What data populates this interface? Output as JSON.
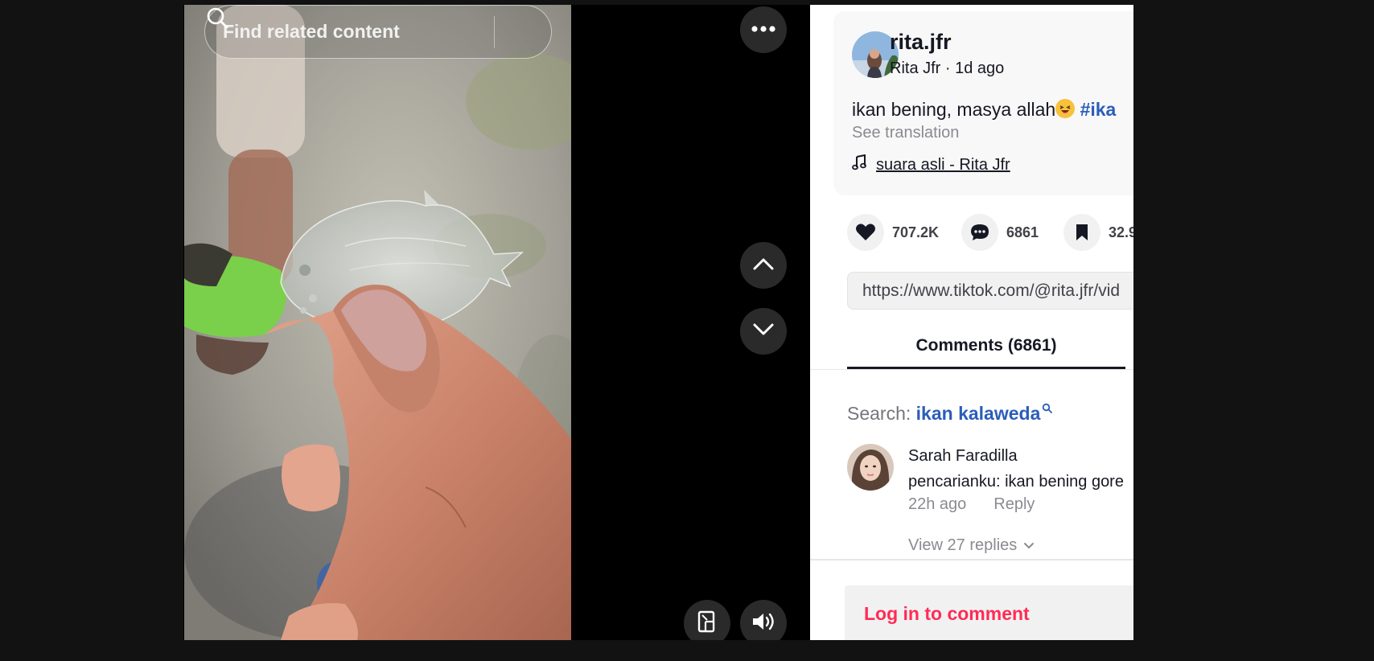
{
  "video": {
    "search_placeholder": "Find related content",
    "icons": [
      "search-icon",
      "more-icon",
      "chevron-up-icon",
      "chevron-down-icon",
      "mini-player-icon",
      "volume-icon"
    ]
  },
  "post": {
    "username": "rita.jfr",
    "display_name": "Rita Jfr",
    "age": "1d ago",
    "subline": "Rita Jfr · 1d ago",
    "caption_text": "ikan bening, masya allah",
    "caption_hashtag": "#ika",
    "see_translation": "See translation",
    "music": "suara asli - Rita Jfr"
  },
  "stats": {
    "likes": "707.2K",
    "comments": "6861",
    "saves": "32.9"
  },
  "share_url": "https://www.tiktok.com/@rita.jfr/vid",
  "tabs": {
    "comments_label": "Comments (6861)"
  },
  "search_suggestion": {
    "prefix": "Search: ",
    "term": "ikan kalaweda"
  },
  "comment": {
    "author": "Sarah Faradilla",
    "text": "pencarianku: ikan bening gore",
    "time": "22h ago",
    "reply_label": "Reply",
    "view_replies": "View 27 replies"
  },
  "login": {
    "label": "Log in to comment"
  },
  "colors": {
    "accent_red": "#fe2c55",
    "link_blue": "#2b5db9",
    "panel_bg": "#ffffff",
    "video_bg": "#000000"
  }
}
